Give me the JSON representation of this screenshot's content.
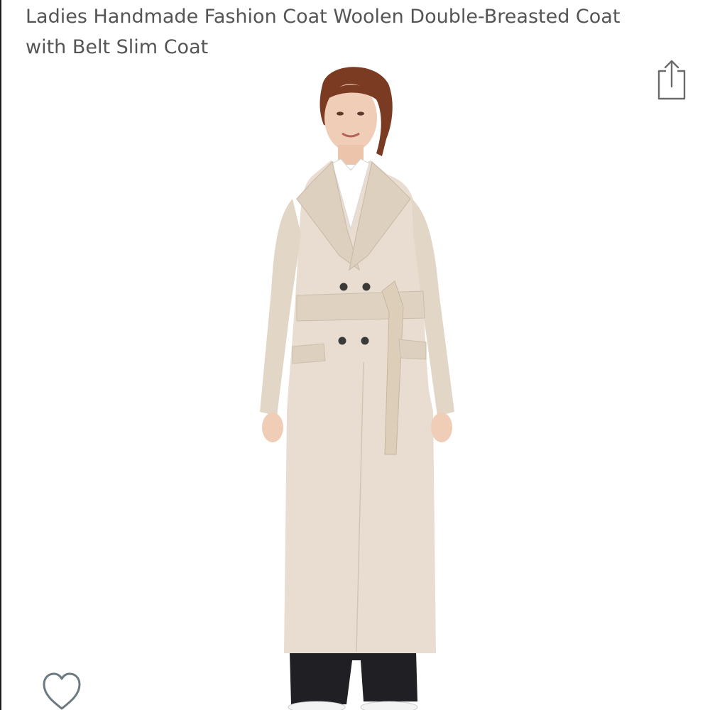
{
  "product": {
    "title": "Ladies Handmade Fashion Coat Woolen Double-Breasted Coat with Belt Slim Coat"
  },
  "icons": {
    "share": "share-icon",
    "favorite": "heart-outline-icon"
  },
  "colors": {
    "title_text": "#555555",
    "icon_stroke": "#6b6b6b",
    "coat": "#e8ddd0"
  }
}
